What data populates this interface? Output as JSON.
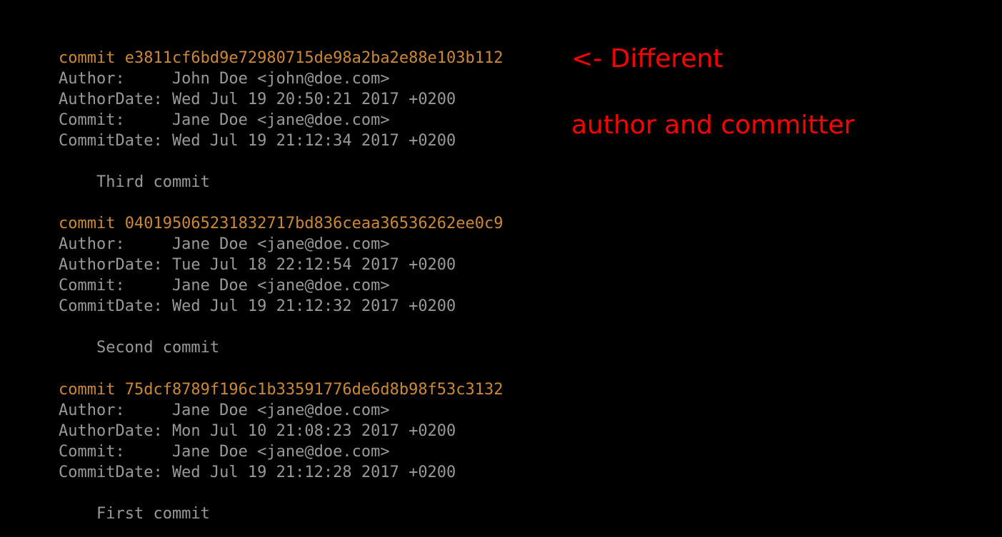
{
  "log": {
    "commits": [
      {
        "commit_line": "commit e3811cf6bd9e72980715de98a2ba2e88e103b112",
        "author_line": "Author:     John Doe <john@doe.com>",
        "author_date_line": "AuthorDate: Wed Jul 19 20:50:21 2017 +0200",
        "commit_by_line": "Commit:     Jane Doe <jane@doe.com>",
        "commit_date_line": "CommitDate: Wed Jul 19 21:12:34 2017 +0200",
        "message_line": "    Third commit"
      },
      {
        "commit_line": "commit 040195065231832717bd836ceaa36536262ee0c9",
        "author_line": "Author:     Jane Doe <jane@doe.com>",
        "author_date_line": "AuthorDate: Tue Jul 18 22:12:54 2017 +0200",
        "commit_by_line": "Commit:     Jane Doe <jane@doe.com>",
        "commit_date_line": "CommitDate: Wed Jul 19 21:12:32 2017 +0200",
        "message_line": "    Second commit"
      },
      {
        "commit_line": "commit 75dcf8789f196c1b33591776de6d8b98f53c3132",
        "author_line": "Author:     Jane Doe <jane@doe.com>",
        "author_date_line": "AuthorDate: Mon Jul 10 21:08:23 2017 +0200",
        "commit_by_line": "Commit:     Jane Doe <jane@doe.com>",
        "commit_date_line": "CommitDate: Wed Jul 19 21:12:28 2017 +0200",
        "message_line": "    First commit"
      }
    ]
  },
  "annotation": {
    "line1": "<- Different",
    "line2": "author and committer"
  }
}
